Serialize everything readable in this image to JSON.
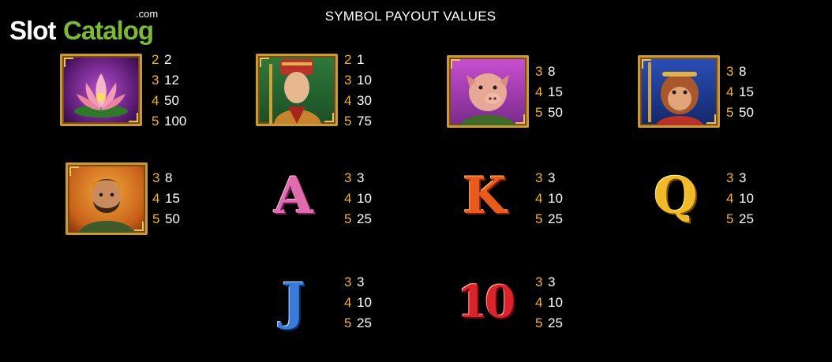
{
  "logo": {
    "part1": "Slot",
    "part2": "Catalog",
    "suffix": ".com"
  },
  "title": "SYMBOL PAYOUT VALUES",
  "symbols": [
    {
      "icon": "lotus-flower-icon",
      "pays": [
        [
          "2",
          "2"
        ],
        [
          "3",
          "12"
        ],
        [
          "4",
          "50"
        ],
        [
          "5",
          "100"
        ]
      ]
    },
    {
      "icon": "monk-portrait-icon",
      "pays": [
        [
          "2",
          "1"
        ],
        [
          "3",
          "10"
        ],
        [
          "4",
          "30"
        ],
        [
          "5",
          "75"
        ]
      ]
    },
    {
      "icon": "pig-portrait-icon",
      "pays": [
        [
          "3",
          "8"
        ],
        [
          "4",
          "15"
        ],
        [
          "5",
          "50"
        ]
      ]
    },
    {
      "icon": "monkey-king-portrait-icon",
      "pays": [
        [
          "3",
          "8"
        ],
        [
          "4",
          "15"
        ],
        [
          "5",
          "50"
        ]
      ]
    },
    {
      "icon": "warrior-portrait-icon",
      "pays": [
        [
          "3",
          "8"
        ],
        [
          "4",
          "15"
        ],
        [
          "5",
          "50"
        ]
      ]
    },
    {
      "label": "A",
      "pays": [
        [
          "3",
          "3"
        ],
        [
          "4",
          "10"
        ],
        [
          "5",
          "25"
        ]
      ]
    },
    {
      "label": "K",
      "pays": [
        [
          "3",
          "3"
        ],
        [
          "4",
          "10"
        ],
        [
          "5",
          "25"
        ]
      ]
    },
    {
      "label": "Q",
      "pays": [
        [
          "3",
          "3"
        ],
        [
          "4",
          "10"
        ],
        [
          "5",
          "25"
        ]
      ]
    },
    {
      "label": "J",
      "pays": [
        [
          "3",
          "3"
        ],
        [
          "4",
          "10"
        ],
        [
          "5",
          "25"
        ]
      ]
    },
    {
      "label": "10",
      "pays": [
        [
          "3",
          "3"
        ],
        [
          "4",
          "10"
        ],
        [
          "5",
          "25"
        ]
      ]
    }
  ]
}
